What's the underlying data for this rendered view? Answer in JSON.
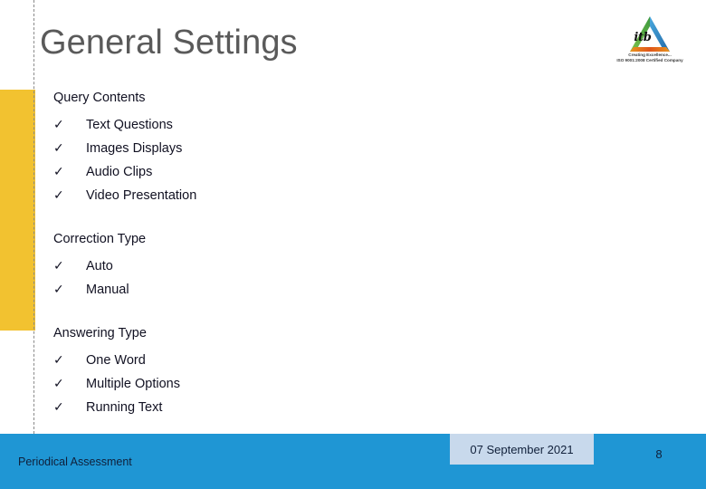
{
  "slide": {
    "title": "General Settings",
    "colors": {
      "title_text": "#5a5a5a",
      "accent_yellow": "#f2c230",
      "footer_blue": "#1f96d4",
      "date_box_blue": "#c8d9ec",
      "body_text": "#111122"
    }
  },
  "content": {
    "groups": [
      {
        "heading": "Query Contents",
        "items": [
          {
            "check": "✓",
            "label": "Text Questions"
          },
          {
            "check": "✓",
            "label": "Images Displays"
          },
          {
            "check": "✓",
            "label": "Audio Clips"
          },
          {
            "check": "✓",
            "label": "Video Presentation"
          }
        ]
      },
      {
        "heading": "Correction Type",
        "items": [
          {
            "check": "✓",
            "label": "Auto"
          },
          {
            "check": "✓",
            "label": "Manual"
          }
        ]
      },
      {
        "heading": "Answering Type",
        "items": [
          {
            "check": "✓",
            "label": "One Word"
          },
          {
            "check": "✓",
            "label": "Multiple Options"
          },
          {
            "check": "✓",
            "label": "Running Text"
          }
        ]
      }
    ]
  },
  "logo": {
    "wordmark": "itb",
    "tagline_line1": "Creating Excellence...",
    "tagline_line2": "ISO 9001:2008 Certified Company",
    "triangle_colors": {
      "left_edge": "#5bb14a",
      "right_edge": "#2f7fc1",
      "bottom_edge": "#e06c1f"
    }
  },
  "footer": {
    "note": "Periodical Assessment",
    "date": "07 September 2021",
    "page_number": "8"
  }
}
